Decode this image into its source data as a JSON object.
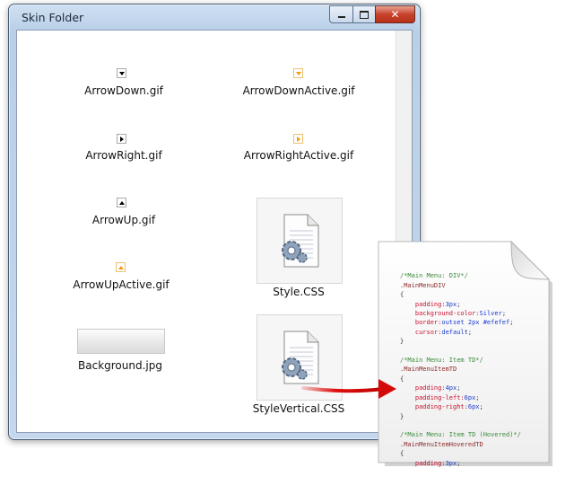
{
  "window": {
    "title": "Skin Folder",
    "controls": {
      "minimize_icon": "minimize-icon",
      "maximize_icon": "maximize-icon",
      "close_icon": "close-icon"
    }
  },
  "files": [
    {
      "name": "ArrowDown.gif",
      "icon": "arrow-down-icon",
      "color": "#000000"
    },
    {
      "name": "ArrowDownActive.gif",
      "icon": "arrow-down-icon",
      "color": "#f59a0c"
    },
    {
      "name": "ArrowRight.gif",
      "icon": "arrow-right-icon",
      "color": "#000000"
    },
    {
      "name": "ArrowRightActive.gif",
      "icon": "arrow-right-icon",
      "color": "#f59a0c"
    },
    {
      "name": "ArrowUp.gif",
      "icon": "arrow-up-icon",
      "color": "#000000"
    },
    {
      "name": "Style.CSS",
      "icon": "css-file-icon"
    },
    {
      "name": "ArrowUpActive.gif",
      "icon": "arrow-up-icon",
      "color": "#f59a0c"
    },
    {
      "name": "Background.jpg",
      "icon": "background-thumbnail"
    },
    {
      "name": "StyleVertical.CSS",
      "icon": "css-file-icon"
    }
  ],
  "callout": {
    "arrow_color": "#e01010",
    "code_lines": [
      "/*Main Menu: DIV*/",
      ".MainMenuDIV",
      "{",
      "    padding:3px;",
      "    background-color:Silver;",
      "    border:outset 2px #efefef;",
      "    cursor:default;",
      "}",
      "",
      "/*Main Menu: Item TD*/",
      ".MainMenuItemTD",
      "{",
      "    padding:4px;",
      "    padding-left:6px;",
      "    padding-right:6px;",
      "}",
      "",
      "/*Main Menu: Item TD (Hovered)*/",
      ".MainMenuItemHoveredTD",
      "{",
      "    padding:3px;"
    ]
  }
}
